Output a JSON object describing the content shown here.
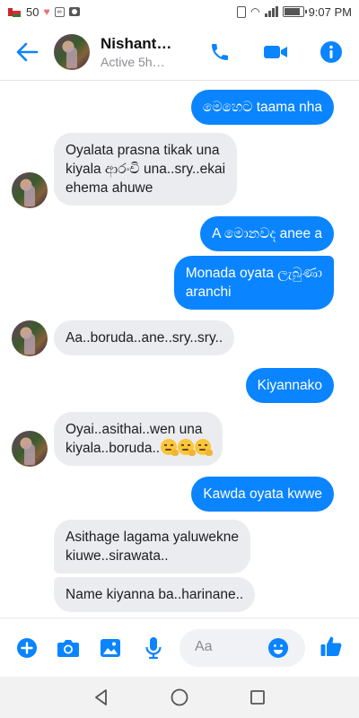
{
  "status_bar": {
    "battery_level_text": "50",
    "time": "9:07 PM"
  },
  "header": {
    "contact_name": "Nishant…",
    "contact_status": "Active 5h…"
  },
  "messages": [
    {
      "direction": "out",
      "text": "මෙහෙට taama nha"
    },
    {
      "direction": "in",
      "lines": [
        "Oyalata prasna tikak una",
        "kiyala ආරංචි una..sry..ekai",
        "ehema ahuwe"
      ]
    },
    {
      "direction": "out",
      "text": "A මොනවද anee a"
    },
    {
      "direction": "out",
      "lines": [
        "Monada oyata ලැබුණා",
        "aranchi"
      ]
    },
    {
      "direction": "in",
      "text": "Aa..boruda..ane..sry..sry.."
    },
    {
      "direction": "out",
      "text": "Kiyannako"
    },
    {
      "direction": "in",
      "lines": [
        "Oyai..asithai..wen una",
        "kiyala..boruda.."
      ],
      "trailing_emoji": [
        "thinking-face",
        "thinking-face",
        "thinking-face"
      ]
    },
    {
      "direction": "out",
      "text": "Kawda oyata kwwe"
    },
    {
      "direction": "in",
      "lines": [
        "Asithage lagama yaluwekne",
        "kiuwe..sirawata.."
      ]
    },
    {
      "direction": "in",
      "text": "Name kiyanna ba..harinane.."
    }
  ],
  "composer": {
    "placeholder": "Aa"
  },
  "colors": {
    "accent": "#0a84ff",
    "incoming_bubble": "#ebecef",
    "outgoing_bubble": "#0a84ff"
  },
  "icons": [
    "back-arrow-icon",
    "phone-icon",
    "video-camera-icon",
    "info-icon",
    "plus-icon",
    "camera-icon",
    "gallery-icon",
    "microphone-icon",
    "smiley-icon",
    "thumbs-up-icon",
    "nav-back-icon",
    "nav-home-icon",
    "nav-recents-icon"
  ]
}
